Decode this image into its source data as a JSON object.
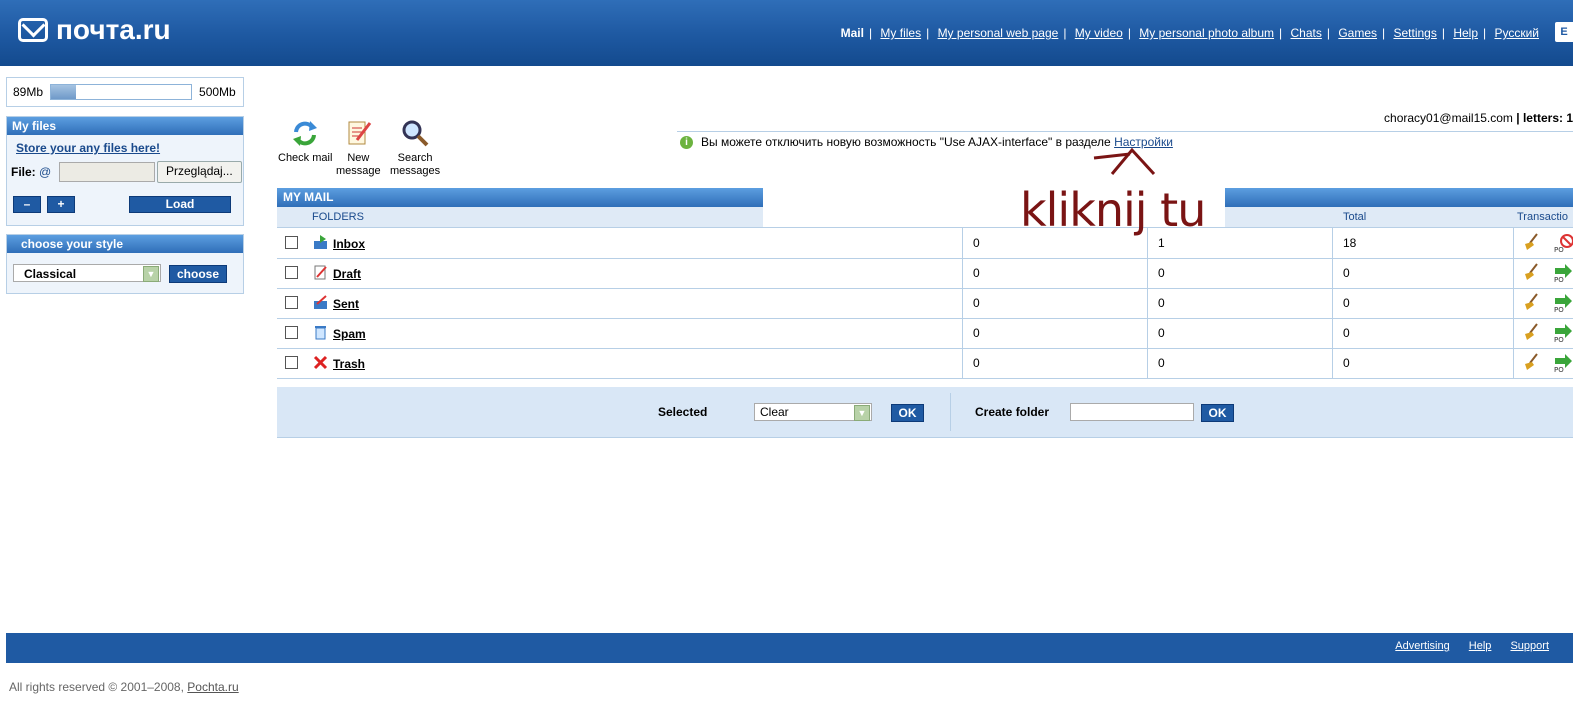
{
  "header": {
    "logo_text": "почта.ru",
    "nav": {
      "current": "Mail",
      "links": [
        "My files",
        "My personal web page",
        "My video",
        "My personal photo album",
        "Chats",
        "Games",
        "Settings",
        "Help",
        "Русский"
      ]
    },
    "exit_label": "E"
  },
  "quota": {
    "used": "89Mb",
    "total": "500Mb",
    "used_fraction": 0.18
  },
  "my_files": {
    "title": "My files",
    "store_link": "Store your any files here!",
    "file_label": "File:",
    "browse_label": "Przeglądaj...",
    "minus_label": "–",
    "plus_label": "+",
    "load_label": "Load"
  },
  "style_box": {
    "title": "choose your style",
    "selected": "Classical",
    "choose_label": "choose"
  },
  "toolbar": {
    "check_mail": "Check mail",
    "new_message_1": "New",
    "new_message_2": "message",
    "search_1": "Search",
    "search_2": "messages"
  },
  "user": {
    "email": "choracy01@mail15.com",
    "letters_label": "| letters: 1"
  },
  "notice": {
    "text": "Вы можете отключить новую возможность \"Use AJAX-interface\" в разделе",
    "link": "Настройки"
  },
  "annotation": "kliknij tu",
  "mail": {
    "title": "MY MAIL",
    "headers": {
      "folders": "FOLDERS",
      "total": "Total",
      "transactions": "Transactio"
    },
    "folders": [
      {
        "name": "Inbox",
        "c1": "0",
        "c2": "1",
        "c3": "18"
      },
      {
        "name": "Draft",
        "c1": "0",
        "c2": "0",
        "c3": "0"
      },
      {
        "name": "Sent",
        "c1": "0",
        "c2": "0",
        "c3": "0"
      },
      {
        "name": "Spam",
        "c1": "0",
        "c2": "0",
        "c3": "0"
      },
      {
        "name": "Trash",
        "c1": "0",
        "c2": "0",
        "c3": "0"
      }
    ]
  },
  "actions": {
    "selected_label": "Selected",
    "selected_value": "Clear",
    "ok1": "OK",
    "create_label": "Create folder",
    "ok2": "OK"
  },
  "footer": {
    "links": [
      "Advertising",
      "Help",
      "Support"
    ],
    "copyright": "All rights reserved © 2001–2008,",
    "copyright_link": "Pochta.ru"
  }
}
